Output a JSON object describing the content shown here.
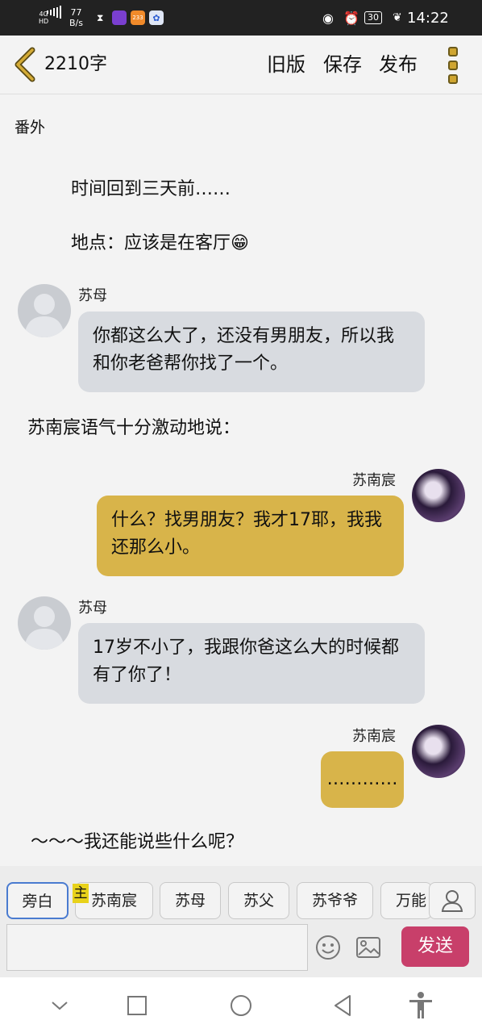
{
  "status_bar": {
    "network": "4G",
    "network_sub": "HD",
    "speed_value": "77",
    "speed_unit": "B/s",
    "app_icon_text": "233",
    "battery": "30",
    "time": "14:22"
  },
  "toolbar": {
    "word_count": "2210字",
    "old_version_label": "旧版",
    "save_label": "保存",
    "publish_label": "发布"
  },
  "content": {
    "chapter_title": "番外",
    "narration_1": "时间回到三天前……",
    "narration_2": "地点：应该是在客厅😁",
    "msg_1": {
      "speaker": "苏母",
      "text": "你都这么大了，还没有男朋友，所以我和你老爸帮你找了一个。"
    },
    "narration_3": "苏南宸语气十分激动地说：",
    "msg_2": {
      "speaker": "苏南宸",
      "text": "什么？找男朋友？我才17耶，我我还那么小。"
    },
    "msg_3": {
      "speaker": "苏母",
      "text": "17岁不小了，我跟你爸这么大的时候都有了你了！"
    },
    "msg_4": {
      "speaker": "苏南宸",
      "text": "…………"
    },
    "narration_4": "～～～我还能说些什么呢？"
  },
  "roles": {
    "items": [
      "旁白",
      "苏南宸",
      "苏母",
      "苏父",
      "苏爷爷",
      "万能"
    ],
    "selected": "旁白",
    "main_badge": "主"
  },
  "input": {
    "send_label": "发送"
  },
  "colors": {
    "accent_gold": "#d8b44a",
    "send_button": "#c83f6a",
    "selected_role_border": "#4a7bd0"
  }
}
